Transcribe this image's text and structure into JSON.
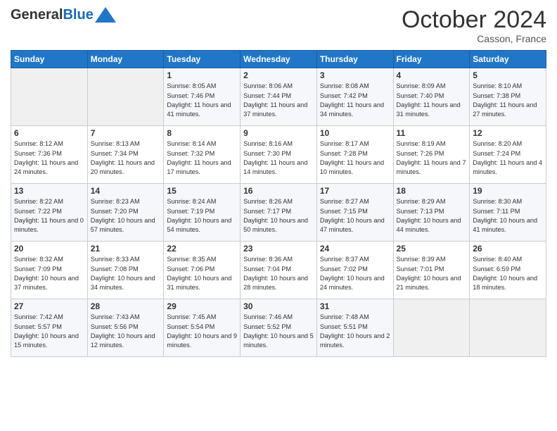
{
  "header": {
    "logo_general": "General",
    "logo_blue": "Blue",
    "month_title": "October 2024",
    "location": "Casson, France"
  },
  "days_of_week": [
    "Sunday",
    "Monday",
    "Tuesday",
    "Wednesday",
    "Thursday",
    "Friday",
    "Saturday"
  ],
  "weeks": [
    [
      {
        "day": "",
        "info": ""
      },
      {
        "day": "",
        "info": ""
      },
      {
        "day": "1",
        "info": "Sunrise: 8:05 AM\nSunset: 7:46 PM\nDaylight: 11 hours and 41 minutes."
      },
      {
        "day": "2",
        "info": "Sunrise: 8:06 AM\nSunset: 7:44 PM\nDaylight: 11 hours and 37 minutes."
      },
      {
        "day": "3",
        "info": "Sunrise: 8:08 AM\nSunset: 7:42 PM\nDaylight: 11 hours and 34 minutes."
      },
      {
        "day": "4",
        "info": "Sunrise: 8:09 AM\nSunset: 7:40 PM\nDaylight: 11 hours and 31 minutes."
      },
      {
        "day": "5",
        "info": "Sunrise: 8:10 AM\nSunset: 7:38 PM\nDaylight: 11 hours and 27 minutes."
      }
    ],
    [
      {
        "day": "6",
        "info": "Sunrise: 8:12 AM\nSunset: 7:36 PM\nDaylight: 11 hours and 24 minutes."
      },
      {
        "day": "7",
        "info": "Sunrise: 8:13 AM\nSunset: 7:34 PM\nDaylight: 11 hours and 20 minutes."
      },
      {
        "day": "8",
        "info": "Sunrise: 8:14 AM\nSunset: 7:32 PM\nDaylight: 11 hours and 17 minutes."
      },
      {
        "day": "9",
        "info": "Sunrise: 8:16 AM\nSunset: 7:30 PM\nDaylight: 11 hours and 14 minutes."
      },
      {
        "day": "10",
        "info": "Sunrise: 8:17 AM\nSunset: 7:28 PM\nDaylight: 11 hours and 10 minutes."
      },
      {
        "day": "11",
        "info": "Sunrise: 8:19 AM\nSunset: 7:26 PM\nDaylight: 11 hours and 7 minutes."
      },
      {
        "day": "12",
        "info": "Sunrise: 8:20 AM\nSunset: 7:24 PM\nDaylight: 11 hours and 4 minutes."
      }
    ],
    [
      {
        "day": "13",
        "info": "Sunrise: 8:22 AM\nSunset: 7:22 PM\nDaylight: 11 hours and 0 minutes."
      },
      {
        "day": "14",
        "info": "Sunrise: 8:23 AM\nSunset: 7:20 PM\nDaylight: 10 hours and 57 minutes."
      },
      {
        "day": "15",
        "info": "Sunrise: 8:24 AM\nSunset: 7:19 PM\nDaylight: 10 hours and 54 minutes."
      },
      {
        "day": "16",
        "info": "Sunrise: 8:26 AM\nSunset: 7:17 PM\nDaylight: 10 hours and 50 minutes."
      },
      {
        "day": "17",
        "info": "Sunrise: 8:27 AM\nSunset: 7:15 PM\nDaylight: 10 hours and 47 minutes."
      },
      {
        "day": "18",
        "info": "Sunrise: 8:29 AM\nSunset: 7:13 PM\nDaylight: 10 hours and 44 minutes."
      },
      {
        "day": "19",
        "info": "Sunrise: 8:30 AM\nSunset: 7:11 PM\nDaylight: 10 hours and 41 minutes."
      }
    ],
    [
      {
        "day": "20",
        "info": "Sunrise: 8:32 AM\nSunset: 7:09 PM\nDaylight: 10 hours and 37 minutes."
      },
      {
        "day": "21",
        "info": "Sunrise: 8:33 AM\nSunset: 7:08 PM\nDaylight: 10 hours and 34 minutes."
      },
      {
        "day": "22",
        "info": "Sunrise: 8:35 AM\nSunset: 7:06 PM\nDaylight: 10 hours and 31 minutes."
      },
      {
        "day": "23",
        "info": "Sunrise: 8:36 AM\nSunset: 7:04 PM\nDaylight: 10 hours and 28 minutes."
      },
      {
        "day": "24",
        "info": "Sunrise: 8:37 AM\nSunset: 7:02 PM\nDaylight: 10 hours and 24 minutes."
      },
      {
        "day": "25",
        "info": "Sunrise: 8:39 AM\nSunset: 7:01 PM\nDaylight: 10 hours and 21 minutes."
      },
      {
        "day": "26",
        "info": "Sunrise: 8:40 AM\nSunset: 6:59 PM\nDaylight: 10 hours and 18 minutes."
      }
    ],
    [
      {
        "day": "27",
        "info": "Sunrise: 7:42 AM\nSunset: 5:57 PM\nDaylight: 10 hours and 15 minutes."
      },
      {
        "day": "28",
        "info": "Sunrise: 7:43 AM\nSunset: 5:56 PM\nDaylight: 10 hours and 12 minutes."
      },
      {
        "day": "29",
        "info": "Sunrise: 7:45 AM\nSunset: 5:54 PM\nDaylight: 10 hours and 9 minutes."
      },
      {
        "day": "30",
        "info": "Sunrise: 7:46 AM\nSunset: 5:52 PM\nDaylight: 10 hours and 5 minutes."
      },
      {
        "day": "31",
        "info": "Sunrise: 7:48 AM\nSunset: 5:51 PM\nDaylight: 10 hours and 2 minutes."
      },
      {
        "day": "",
        "info": ""
      },
      {
        "day": "",
        "info": ""
      }
    ]
  ]
}
